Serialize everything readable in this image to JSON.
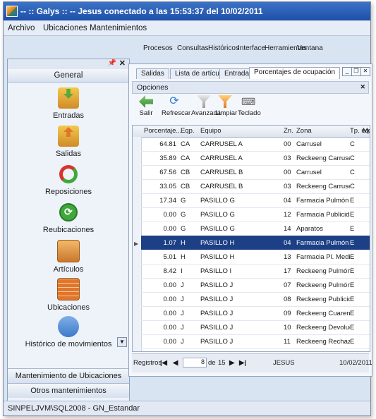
{
  "window": {
    "title": "-- :: Galys :: -- Jesus conectado a las 15:53:37 del 10/02/2011"
  },
  "menu": [
    "Archivo",
    "Ubicaciones",
    "Mantenimientos",
    "Procesos",
    "Consultas",
    "Históricos",
    "Interface",
    "Herramientas",
    "Ventana"
  ],
  "sidebar": {
    "group": "General",
    "items": [
      {
        "label": "Entradas",
        "color": "#5aa83a"
      },
      {
        "label": "Salidas",
        "color": "#e0762b"
      },
      {
        "label": "Reposiciones",
        "color": "#d9342b"
      },
      {
        "label": "Reubicaciones",
        "color": "#3fa83a"
      },
      {
        "label": "Artículos",
        "color": "#d78a3a"
      },
      {
        "label": "Ubicaciones",
        "color": "#e0762b"
      },
      {
        "label": "Histórico de movimientos",
        "color": "#3d78c8"
      }
    ],
    "footers": [
      "Mantenimiento de Ubicaciones",
      "Otros mantenimientos"
    ]
  },
  "status": "SINPELJVM\\SQL2008 - GN_Estandar",
  "tabs": [
    "Salidas",
    "Lista de artículos",
    "Entradas",
    "Porcentajes de ocupación"
  ],
  "options_label": "Opciones",
  "toolbar": [
    "Salir",
    "Refrescar",
    "Avanzada",
    "Limpiar",
    "Teclado"
  ],
  "grid": {
    "headers": [
      "Porcentaje...",
      "Eqp.",
      "Equipo",
      "Zn.",
      "Zona",
      "Tp. eqz.",
      "Mo"
    ],
    "rows": [
      [
        "64.81",
        "CA",
        "CARRUSEL A",
        "00",
        "Carrusel",
        "C"
      ],
      [
        "35.89",
        "CA",
        "CARRUSEL A",
        "03",
        "Reckeeng Carrusel",
        "C"
      ],
      [
        "67.56",
        "CB",
        "CARRUSEL B",
        "00",
        "Carrusel",
        "C"
      ],
      [
        "33.05",
        "CB",
        "CARRUSEL B",
        "03",
        "Reckeeng Carrusel",
        "C"
      ],
      [
        "17.34",
        "G",
        "PASILLO G",
        "04",
        "Farmacia Pulmón",
        "E"
      ],
      [
        "0.00",
        "G",
        "PASILLO G",
        "12",
        "Farmacia Publicidad",
        "E"
      ],
      [
        "0.00",
        "G",
        "PASILLO G",
        "14",
        "Aparatos",
        "E"
      ],
      [
        "1.07",
        "H",
        "PASILLO H",
        "04",
        "Farmacia Pulmón",
        "E"
      ],
      [
        "5.01",
        "H",
        "PASILLO H",
        "13",
        "Farmacia Pl. Medicinal",
        "E"
      ],
      [
        "8.42",
        "I",
        "PASILLO I",
        "17",
        "Reckeeng Pulmón",
        "E"
      ],
      [
        "0.00",
        "J",
        "PASILLO J",
        "07",
        "Reckeeng Pulmón",
        "E"
      ],
      [
        "0.00",
        "J",
        "PASILLO J",
        "08",
        "Reckeeng Publicidad",
        "E"
      ],
      [
        "0.00",
        "J",
        "PASILLO J",
        "09",
        "Reckeeng Cuarentena",
        "E"
      ],
      [
        "0.00",
        "J",
        "PASILLO J",
        "10",
        "Reckeeng Devoluciones",
        "E"
      ],
      [
        "0.00",
        "J",
        "PASILLO J",
        "11",
        "Reckeeng Rechazados",
        "E"
      ]
    ]
  },
  "nav": {
    "label": "Registros",
    "current": "8",
    "of": "de",
    "total": "15",
    "user": "JESUS",
    "date": "10/02/2011"
  }
}
